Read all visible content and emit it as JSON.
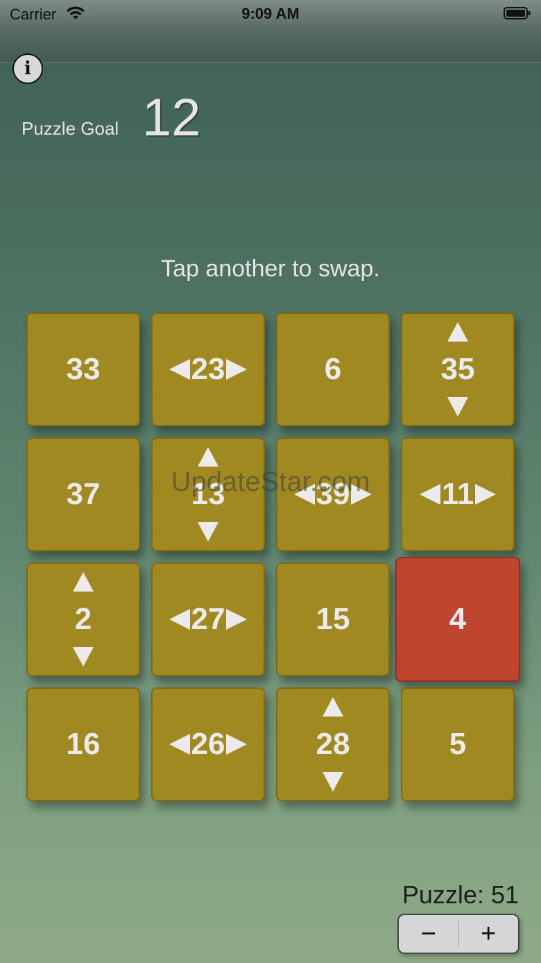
{
  "status_bar": {
    "carrier": "Carrier",
    "time": "9:09 AM"
  },
  "goal": {
    "label": "Puzzle Goal",
    "value": "12"
  },
  "instruction": "Tap another to swap.",
  "watermark": "UpdateStar.com",
  "tiles": [
    {
      "value": "33",
      "arrows": "none"
    },
    {
      "value": "23",
      "arrows": "horizontal"
    },
    {
      "value": "6",
      "arrows": "none"
    },
    {
      "value": "35",
      "arrows": "vertical"
    },
    {
      "value": "37",
      "arrows": "none"
    },
    {
      "value": "13",
      "arrows": "vertical"
    },
    {
      "value": "39",
      "arrows": "horizontal"
    },
    {
      "value": "11",
      "arrows": "horizontal"
    },
    {
      "value": "2",
      "arrows": "vertical"
    },
    {
      "value": "27",
      "arrows": "horizontal"
    },
    {
      "value": "15",
      "arrows": "none"
    },
    {
      "value": "4",
      "arrows": "none",
      "selected": true
    },
    {
      "value": "16",
      "arrows": "none"
    },
    {
      "value": "26",
      "arrows": "horizontal"
    },
    {
      "value": "28",
      "arrows": "vertical"
    },
    {
      "value": "5",
      "arrows": "none"
    }
  ],
  "puzzle": {
    "label": "Puzzle: 51",
    "decrement": "−",
    "increment": "+"
  },
  "colors": {
    "tile": "#a08920",
    "tile_selected": "#bf452e",
    "text": "#eceaea"
  }
}
